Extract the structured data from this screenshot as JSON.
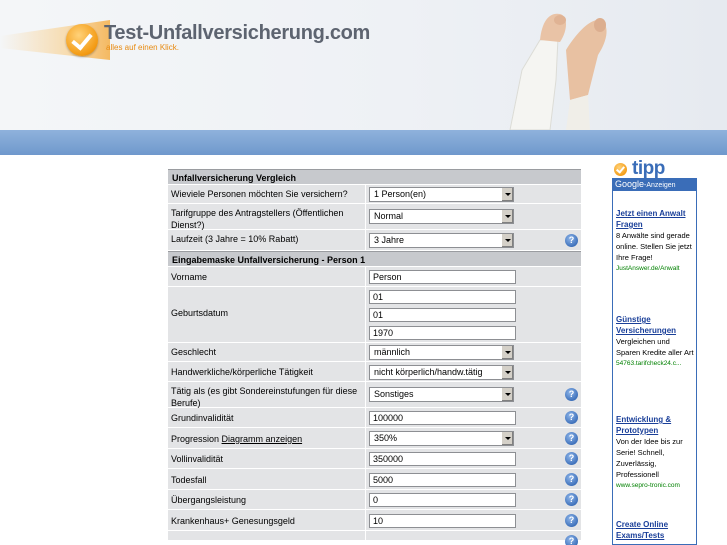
{
  "header": {
    "logo_title": "Test-Unfallversicherung.com",
    "logo_subtitle": "alles auf einen Klick."
  },
  "form": {
    "section1": "Unfallversicherung Vergleich",
    "rows1": [
      {
        "label": "Wieviele Personen möchten Sie versichern?",
        "value": "1 Person(en)"
      },
      {
        "label": "Tarifgruppe des Antragstellers (Öffentlichen Dienst?)",
        "value": "Normal"
      },
      {
        "label": "Laufzeit (3 Jahre = 10% Rabatt)",
        "value": "3 Jahre"
      }
    ],
    "section2": "Eingabemaske Unfallversicherung - Person 1",
    "vorname_label": "Vorname",
    "vorname_value": "Person",
    "geburt_label": "Geburtsdatum",
    "geburt_day": "01",
    "geburt_month": "01",
    "geburt_year": "1970",
    "geschlecht_label": "Geschlecht",
    "geschlecht_value": "männlich",
    "taetigkeit_label": "Handwerkliche/körperliche Tätigkeit",
    "taetigkeit_value": "nicht körperlich/handw.tätig",
    "beruf_label": "Tätig als (es gibt Sondereinstufungen für diese Berufe)",
    "beruf_value": "Sonstiges",
    "grund_label": "Grundinvalidität",
    "grund_value": "100000",
    "prog_label": "Progression",
    "prog_link": "Diagramm anzeigen",
    "prog_value": "350%",
    "voll_label": "Vollinvalidität",
    "voll_value": "350000",
    "tod_label": "Todesfall",
    "tod_value": "5000",
    "ueber_label": "Übergangsleistung",
    "ueber_value": "0",
    "kranken_label": "Krankenhaus+ Genesungsgeld",
    "kranken_value": "10",
    "help_glyph": "?"
  },
  "sidebar": {
    "tipp": "tipp",
    "ads_header_brand": "Google",
    "ads_header_text": "-Anzeigen",
    "ads": [
      {
        "title": "Jetzt einen Anwalt Fragen",
        "text": "8 Anwälte sind gerade online. Stellen Sie jetzt Ihre Frage!",
        "url": "JustAnswer.de/Anwalt"
      },
      {
        "title": "Günstige Versicherungen",
        "text": "Vergleichen und Sparen Kredite aller Art",
        "url": "54763.tarifcheck24.c..."
      },
      {
        "title": "Entwicklung & Prototypen",
        "text": "Von der Idee bis zur Serie! Schnell, Zuverlässig, Professionell",
        "url": "www.sepro-tronic.com"
      },
      {
        "title": "Create Online Exams/Tests",
        "text": "",
        "url": ""
      }
    ]
  }
}
